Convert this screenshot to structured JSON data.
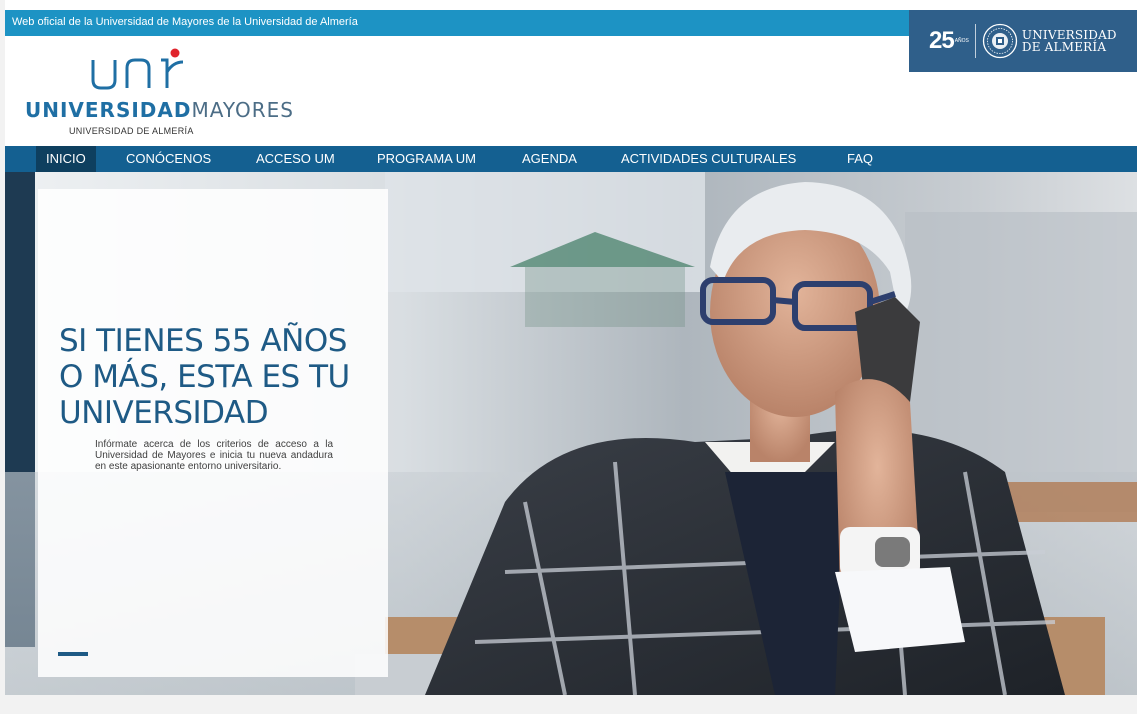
{
  "topbar": {
    "text": "Web oficial de la Universidad de Mayores de la Universidad de Almería"
  },
  "ual_badge": {
    "anniversary": "25",
    "anniversary_small": "AÑOS",
    "name_line1": "UNIVERSIDAD",
    "name_line2": "DE ALMERÍA"
  },
  "logo": {
    "mark_text": "unir",
    "wordmark_bold": "UNIVERSIDAD",
    "wordmark_light": "MAYORES",
    "subtitle": "UNIVERSIDAD DE ALMERÍA"
  },
  "nav": {
    "items": [
      {
        "label": "INICIO",
        "active": true
      },
      {
        "label": "CONÓCENOS"
      },
      {
        "label": "ACCESO UM"
      },
      {
        "label": "PROGRAMA UM"
      },
      {
        "label": "AGENDA"
      },
      {
        "label": "ACTIVIDADES CULTURALES"
      },
      {
        "label": "FAQ"
      }
    ]
  },
  "hero": {
    "title": "SI TIENES 55 AÑOS O MÁS, ESTA ES TU UNIVERSIDAD",
    "text": "Infórmate acerca de los criterios de acceso a la Universidad de Mayores e inicia tu nueva andadura en este apasionante entorno universitario."
  },
  "colors": {
    "topbar": "#1d93c4",
    "navbar": "#146091",
    "nav_active": "#0e3f5f",
    "brand_blue": "#1e5a85",
    "logo_red": "#e0242c"
  }
}
